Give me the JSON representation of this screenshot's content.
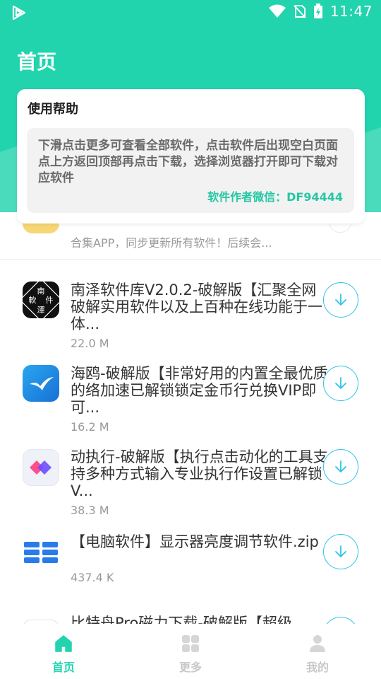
{
  "status_bar": {
    "time": "11:47"
  },
  "page": {
    "title": "首页"
  },
  "help": {
    "title": "使用帮助",
    "text": "下滑点击更多可查看全部软件，点击软件后出现空白页面点上方返回顶部再点击下载，选择浏览器打开即可下载对应软件",
    "wechat": "软件作者微信：DF94444"
  },
  "partial_item": {
    "desc": "合集APP，同步更新所有软件！后续会..."
  },
  "apps": [
    {
      "name": "南泽软件库V2.0.2-破解版【汇聚全网破解实用软件以及上百种在线功能于一体...",
      "size": "22.0 M",
      "icon": "nanze-seal-icon",
      "icon_chars": {
        "top": "南",
        "left": "軟",
        "right": "件",
        "bottom": "澤"
      }
    },
    {
      "name": "海鸥-破解版【非常好用的内置全最优质的络加速已解锁锁定金币行兑换VIP即可...",
      "size": "16.2 M",
      "icon": "seagull-icon"
    },
    {
      "name": "动执行-破解版【执行点击动化的工具支持多种方式输入专业执行作设置已解锁V...",
      "size": "38.3 M",
      "icon": "automation-diamond-icon"
    },
    {
      "name": "【电脑软件】显示器亮度调节软件.zip",
      "size": "437.4 K",
      "icon": "monitor-brightness-icon"
    },
    {
      "name": "比特舟Pro磁力下载-破解版【超级",
      "size": "",
      "icon": "app-icon"
    }
  ],
  "bottom_nav": [
    {
      "label": "首页",
      "icon": "home-icon",
      "active": true
    },
    {
      "label": "更多",
      "icon": "grid-icon",
      "active": false
    },
    {
      "label": "我的",
      "icon": "user-icon",
      "active": false
    }
  ],
  "colors": {
    "accent": "#22d4ae",
    "download_ring": "#2ec3e8",
    "inactive": "#cccccc"
  }
}
